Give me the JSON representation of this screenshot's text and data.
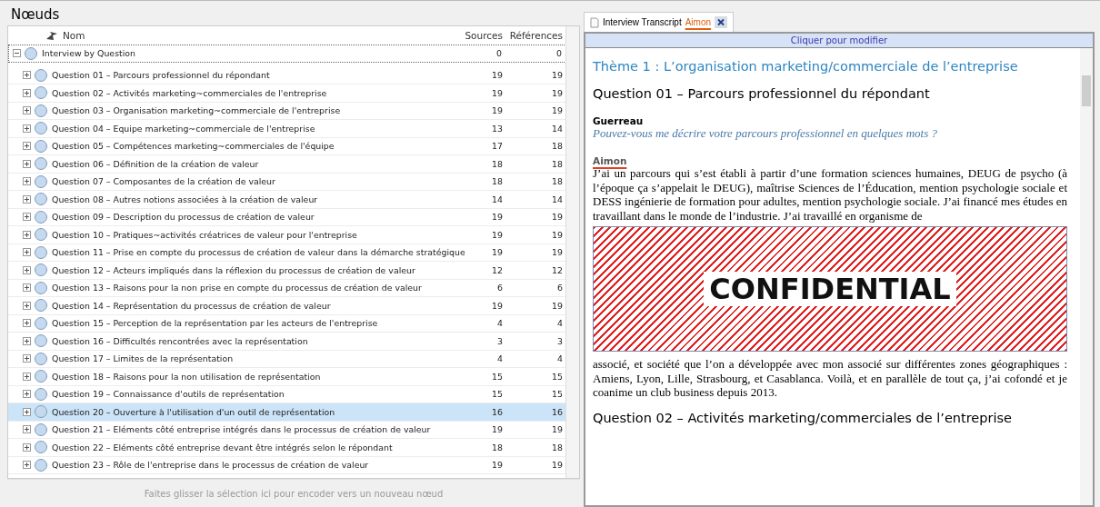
{
  "nodes_panel": {
    "title": "Nœuds",
    "columns": [
      "Nom",
      "Sources",
      "Références"
    ],
    "tree": [
      {
        "name": "Interview by Question",
        "sources": "0",
        "references": "0",
        "expanded": true,
        "selected": false,
        "children": [
          {
            "name": "Question 01 – Parcours professionnel du répondant",
            "sources": "19",
            "references": "19",
            "selected": false
          },
          {
            "name": "Question 02 – Activités marketing~commerciales de l'entreprise",
            "sources": "19",
            "references": "19",
            "selected": false
          },
          {
            "name": "Question 03 – Organisation marketing~commerciale de l'entreprise",
            "sources": "19",
            "references": "19",
            "selected": false
          },
          {
            "name": "Question 04 – Equipe marketing~commerciale de l'entreprise",
            "sources": "13",
            "references": "14",
            "selected": false
          },
          {
            "name": "Question 05 – Compétences marketing~commerciales de l'équipe",
            "sources": "17",
            "references": "18",
            "selected": false
          },
          {
            "name": "Question 06 – Définition de la création de valeur",
            "sources": "18",
            "references": "18",
            "selected": false
          },
          {
            "name": "Question 07 – Composantes de la création de valeur",
            "sources": "18",
            "references": "18",
            "selected": false
          },
          {
            "name": "Question 08 – Autres notions associées à la création de valeur",
            "sources": "14",
            "references": "14",
            "selected": false
          },
          {
            "name": "Question 09 – Description du processus de création de valeur",
            "sources": "19",
            "references": "19",
            "selected": false
          },
          {
            "name": "Question 10 – Pratiques~activités créatrices de valeur pour l'entreprise",
            "sources": "19",
            "references": "19",
            "selected": false
          },
          {
            "name": "Question 11 – Prise en compte du processus de création de valeur dans la démarche stratégique",
            "sources": "19",
            "references": "19",
            "selected": false
          },
          {
            "name": "Question 12 – Acteurs impliqués dans la réflexion du processus de création de valeur",
            "sources": "12",
            "references": "12",
            "selected": false
          },
          {
            "name": "Question 13 – Raisons pour la non prise en compte du processus de création de valeur",
            "sources": "6",
            "references": "6",
            "selected": false
          },
          {
            "name": "Question 14 – Représentation du processus de création de valeur",
            "sources": "19",
            "references": "19",
            "selected": false
          },
          {
            "name": "Question 15 – Perception de la représentation par les acteurs de l'entreprise",
            "sources": "4",
            "references": "4",
            "selected": false
          },
          {
            "name": "Question 16 – Difficultés rencontrées avec la représentation",
            "sources": "3",
            "references": "3",
            "selected": false
          },
          {
            "name": "Question 17 – Limites de la représentation",
            "sources": "4",
            "references": "4",
            "selected": false
          },
          {
            "name": "Question 18 – Raisons pour la non utilisation de représentation",
            "sources": "15",
            "references": "15",
            "selected": false
          },
          {
            "name": "Question 19 – Connaissance d'outils de représentation",
            "sources": "15",
            "references": "15",
            "selected": false
          },
          {
            "name": "Question 20 – Ouverture à l'utilisation d'un outil de représentation",
            "sources": "16",
            "references": "16",
            "selected": true
          },
          {
            "name": "Question 21 – Eléments côté entreprise intégrés dans le processus de création de valeur",
            "sources": "19",
            "references": "19",
            "selected": false
          },
          {
            "name": "Question 22 – Eléments côté entreprise devant être intégrés selon le répondant",
            "sources": "18",
            "references": "18",
            "selected": false
          },
          {
            "name": "Question 23 – Rôle de l'entreprise dans le processus de création de valeur",
            "sources": "19",
            "references": "19",
            "selected": false
          }
        ]
      }
    ],
    "drop_hint": "Faites glisser la sélection ici pour encoder vers un nouveau nœud"
  },
  "document_panel": {
    "tab": {
      "title": "Interview Transcript",
      "struck_name": "Aimon",
      "selected": true
    },
    "edit_bar": "Cliquer pour modifier",
    "blocks": [
      {
        "kind": "theme",
        "text": "Thème 1 : L’organisation marketing/commerciale de l’entreprise"
      },
      {
        "kind": "heading",
        "text": "Question 01 – Parcours professionnel du répondant"
      },
      {
        "kind": "speaker",
        "text": "Guerreau",
        "struck": false
      },
      {
        "kind": "question",
        "text": "Pouvez-vous me décrire votre parcours professionnel en quelques mots ?"
      },
      {
        "kind": "speaker",
        "text": "Aimon",
        "struck": true
      },
      {
        "kind": "answer",
        "text": "J’ai un parcours qui s’est établi à partir d’une formation sciences humaines, DEUG de psycho (à l’époque ça s’appelait le DEUG), maîtrise Sciences de l’Éducation, mention psychologie sociale et DESS ingénierie de formation pour adultes, mention psychologie sociale. J’ai financé mes études en travaillant dans le monde de l’industrie. J’ai travaillé en organisme de"
      },
      {
        "kind": "redaction",
        "text": "CONFIDENTIAL"
      },
      {
        "kind": "answer",
        "text": "associé, et société que l’on a développée avec mon associé sur différentes zones géographiques : Amiens, Lyon, Lille, Strasbourg, et Casablanca. Voilà, et en parallèle de tout ça, j’ai cofondé et je coanime un club business depuis 2013."
      },
      {
        "kind": "heading",
        "text": "Question 02 – Activités marketing/commerciales de l’entreprise"
      }
    ]
  }
}
